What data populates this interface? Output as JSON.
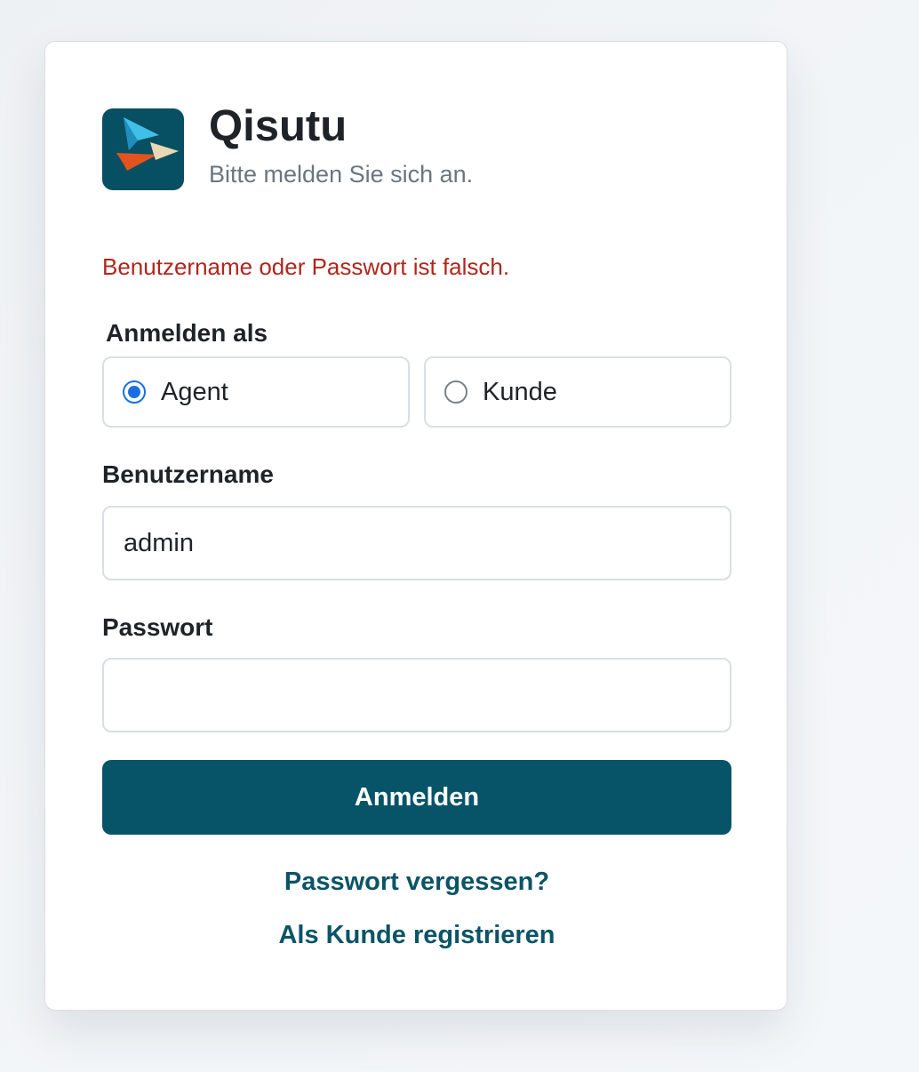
{
  "app": {
    "title": "Qisutu",
    "subtitle": "Bitte melden Sie sich an.",
    "logo_icon": "paper-plane-arrows-logo",
    "brand_color": "#075367"
  },
  "error": {
    "message": "Benutzername oder Passwort ist falsch.",
    "color": "#b1261c"
  },
  "login_as": {
    "label": "Anmelden als",
    "options": [
      {
        "label": "Agent",
        "selected": true
      },
      {
        "label": "Kunde",
        "selected": false
      }
    ]
  },
  "username": {
    "label": "Benutzername",
    "value": "admin"
  },
  "password": {
    "label": "Passwort",
    "value": ""
  },
  "actions": {
    "submit_label": "Anmelden",
    "forgot_label": "Passwort vergessen?",
    "register_label": "Als Kunde registrieren"
  }
}
